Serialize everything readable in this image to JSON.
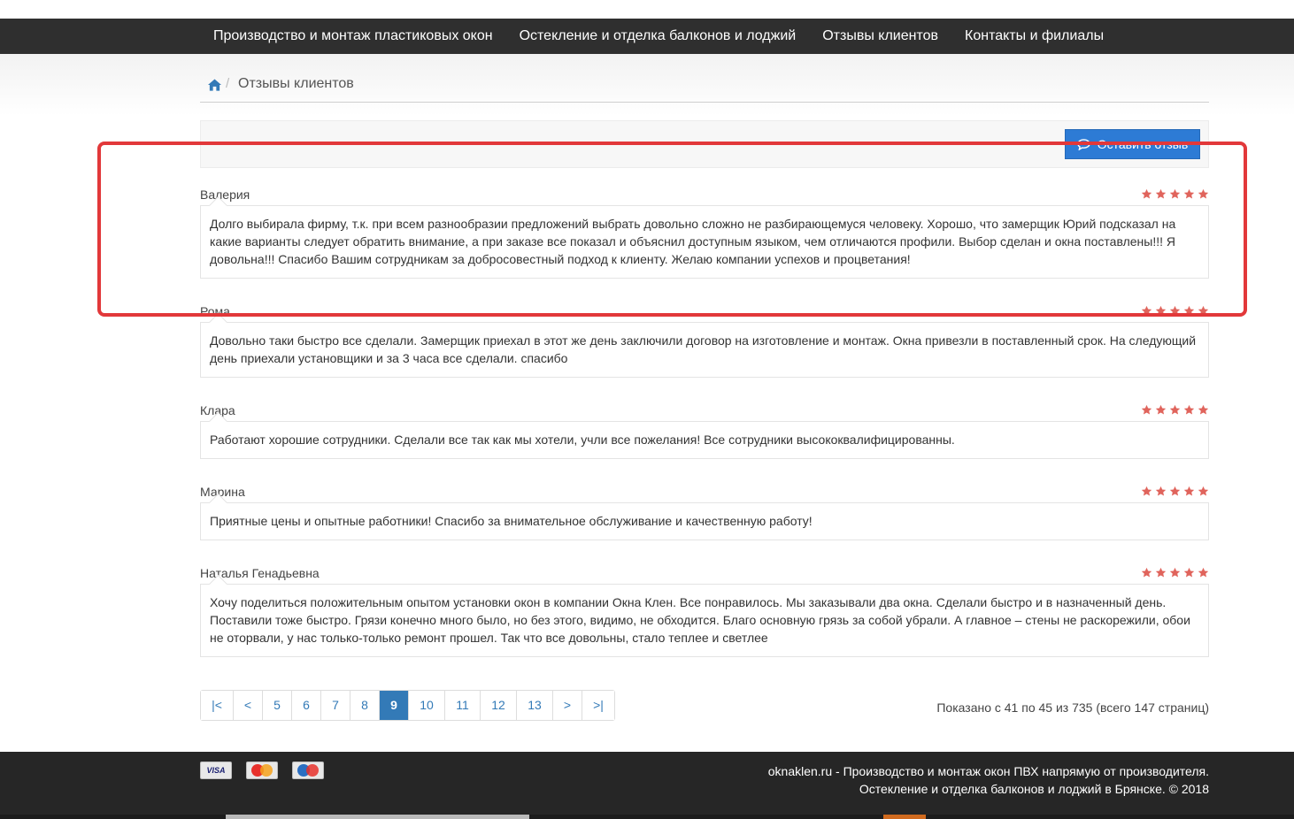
{
  "nav": {
    "items": [
      "Производство и монтаж пластиковых окон",
      "Остекление и отделка балконов и лоджий",
      "Отзывы клиентов",
      "Контакты и филиалы"
    ]
  },
  "breadcrumb": {
    "home_icon": "home-icon",
    "separator": "/",
    "current": "Отзывы клиентов"
  },
  "toolbar": {
    "leave_review_label": "Оставить отзыв",
    "leave_review_icon": "comment-icon"
  },
  "reviews": [
    {
      "author": "Валерия",
      "rating": 5,
      "text": "Долго выбирала фирму, т.к. при всем разнообразии предложений выбрать довольно сложно не разбирающемуся человеку. Хорошо, что замерщик Юрий подсказал на какие варианты следует обратить внимание, а при заказе все показал и объяснил доступным языком, чем отличаются профили. Выбор сделан и окна поставлены!!! Я довольна!!! Спасибо Вашим сотрудникам за добросовестный подход к клиенту. Желаю компании успехов и процветания!"
    },
    {
      "author": "Рома",
      "rating": 5,
      "text": "Довольно таки быстро все сделали. Замерщик приехал в этот же день заключили договор на изготовление и монтаж. Окна привезли в поставленный срок. На следующий день приехали установщики и за 3 часа все сделали. спасибо"
    },
    {
      "author": "Клара",
      "rating": 5,
      "text": "Работают хорошие сотрудники. Сделали все так как мы хотели, учли все пожелания! Все сотрудники высококвалифицированны."
    },
    {
      "author": "Марина",
      "rating": 5,
      "text": "Приятные цены и опытные работники! Спасибо за внимательное обслуживание и качественную работу!"
    },
    {
      "author": "Наталья Генадьевна",
      "rating": 5,
      "text": "Хочу поделиться положительным опытом установки окон в компании Окна Клен. Все понравилось. Мы заказывали два окна. Сделали быстро и в назначенный день. Поставили тоже быстро. Грязи конечно много было, но без этого, видимо, не обходится. Благо основную грязь за собой убрали. А главное – стены не раскорежили, обои не оторвали, у нас только-только ремонт прошел. Так что все довольны, стало теплее и светлее"
    }
  ],
  "pagination": {
    "first": "|<",
    "prev": "<",
    "pages": [
      "5",
      "6",
      "7",
      "8",
      "9",
      "10",
      "11",
      "12",
      "13"
    ],
    "active": "9",
    "next": ">",
    "last": ">|",
    "summary": "Показано с 41 по 45 из 735 (всего 147 страниц)"
  },
  "footer": {
    "cards": [
      {
        "name": "visa-icon",
        "label": "VISA"
      },
      {
        "name": "mastercard-icon",
        "label": ""
      },
      {
        "name": "maestro-icon",
        "label": ""
      }
    ],
    "line1": "oknaklen.ru - Производство и монтаж окон ПВХ напрямую от производителя.",
    "line2": "Остекление и отделка балконов и лоджий в Брянске. © 2018"
  },
  "colors": {
    "nav_bg": "#2f2f2f",
    "accent": "#2d7bd5",
    "star": "#e0645c",
    "highlight": "#e2383a",
    "footer_bg": "#262626"
  }
}
